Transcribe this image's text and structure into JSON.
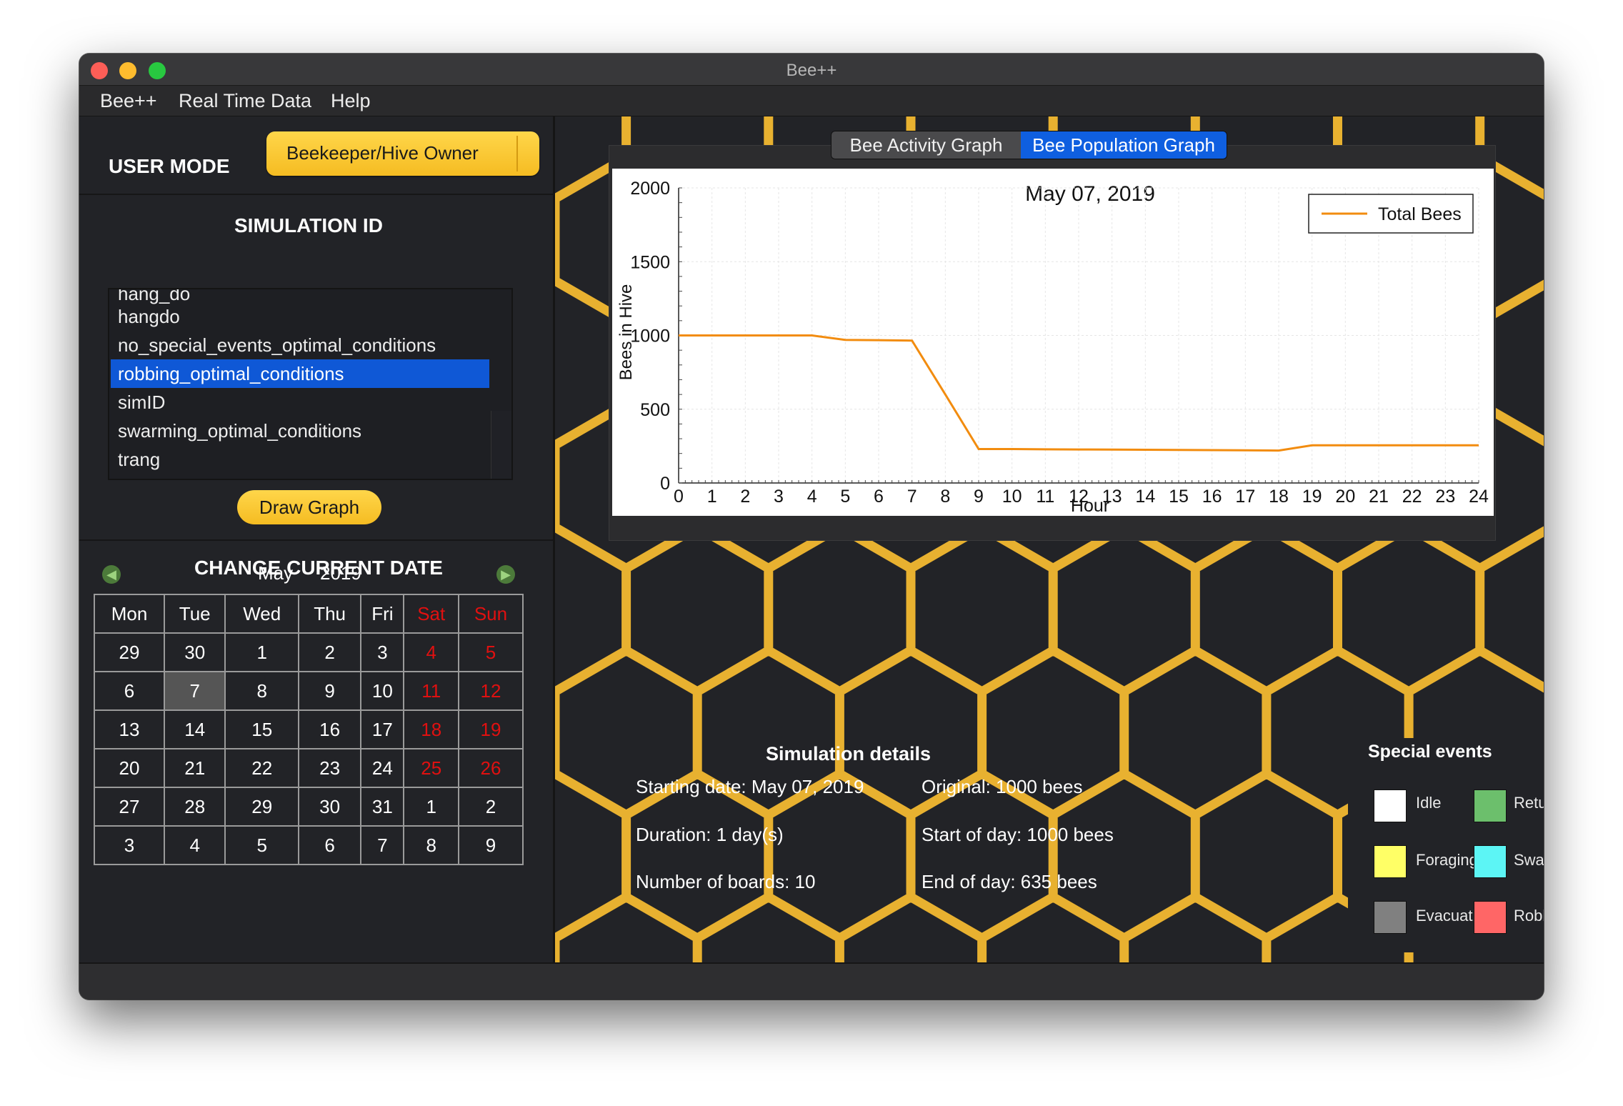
{
  "window": {
    "title": "Bee++"
  },
  "menu": [
    "Bee++",
    "Real Time Data",
    "Help"
  ],
  "user_mode": {
    "label": "USER MODE",
    "value": "Beekeeper/Hive Owner"
  },
  "simulation": {
    "label": "SIMULATION ID",
    "items": [
      "hang_do",
      "hangdo",
      "no_special_events_optimal_conditions",
      "robbing_optimal_conditions",
      "simID",
      "swarming_optimal_conditions",
      "trang"
    ],
    "selected": "robbing_optimal_conditions",
    "draw_button": "Draw Graph"
  },
  "calendar": {
    "label": "CHANGE CURRENT DATE",
    "month": "May",
    "year": "2019",
    "weekdays": [
      "Mon",
      "Tue",
      "Wed",
      "Thu",
      "Fri",
      "Sat",
      "Sun"
    ],
    "weeks": [
      [
        "29",
        "30",
        "1",
        "2",
        "3",
        "4",
        "5"
      ],
      [
        "6",
        "7",
        "8",
        "9",
        "10",
        "11",
        "12"
      ],
      [
        "13",
        "14",
        "15",
        "16",
        "17",
        "18",
        "19"
      ],
      [
        "20",
        "21",
        "22",
        "23",
        "24",
        "25",
        "26"
      ],
      [
        "27",
        "28",
        "29",
        "30",
        "31",
        "1",
        "2"
      ],
      [
        "3",
        "4",
        "5",
        "6",
        "7",
        "8",
        "9"
      ]
    ],
    "selected_day": "7",
    "weekend_color": "#e01010",
    "nav_prev_icon": "arrow-left-icon",
    "nav_next_icon": "arrow-right-icon"
  },
  "tabs": [
    "Bee Activity Graph",
    "Bee Population Graph"
  ],
  "active_tab": "Bee Population Graph",
  "chart_data": {
    "type": "line",
    "title": "May 07, 2019",
    "xlabel": "Hour",
    "ylabel": "Bees in Hive",
    "xlim": [
      0,
      24
    ],
    "ylim": [
      0,
      2000
    ],
    "xticks": [
      "0",
      "1",
      "2",
      "3",
      "4",
      "5",
      "6",
      "7",
      "8",
      "9",
      "10",
      "11",
      "12",
      "13",
      "14",
      "15",
      "16",
      "17",
      "18",
      "19",
      "20",
      "21",
      "22",
      "23",
      "24"
    ],
    "yticks": [
      "0",
      "500",
      "1000",
      "1500",
      "2000"
    ],
    "grid": true,
    "legend_position": "top-right",
    "series": [
      {
        "name": "Total Bees",
        "color": "#f28c0f",
        "x": [
          0,
          1,
          2,
          3,
          4,
          5,
          6,
          7,
          8,
          9,
          10,
          11,
          12,
          13,
          14,
          15,
          16,
          17,
          18,
          19,
          20,
          21,
          22,
          23,
          24
        ],
        "y": [
          1000,
          1000,
          1000,
          1000,
          1000,
          970,
          968,
          965,
          600,
          230,
          230,
          228,
          227,
          226,
          225,
          224,
          223,
          222,
          220,
          255,
          255,
          255,
          255,
          255,
          255
        ]
      }
    ]
  },
  "details": {
    "title": "Simulation details",
    "starting_date": "Starting date: May 07, 2019",
    "duration": "Duration: 1 day(s)",
    "boards": "Number of boards: 10",
    "original": "Original: 1000 bees",
    "start_of_day": "Start of day: 1000 bees",
    "end_of_day": "End of day: 635 bees"
  },
  "events": {
    "title": "Special events",
    "items": [
      {
        "label": "Idle",
        "color": "#ffffff"
      },
      {
        "label": "Returning",
        "color": "#6cbf6c"
      },
      {
        "label": "Foraging",
        "color": "#ffff66"
      },
      {
        "label": "Swarming",
        "color": "#5cf5f5"
      },
      {
        "label": "Evacuation",
        "color": "#808080"
      },
      {
        "label": "Robbing",
        "color": "#ff6666"
      }
    ]
  },
  "colors": {
    "accent": "#f5bc22",
    "honeycomb": "#e8b130",
    "selection": "#0f58d6"
  }
}
